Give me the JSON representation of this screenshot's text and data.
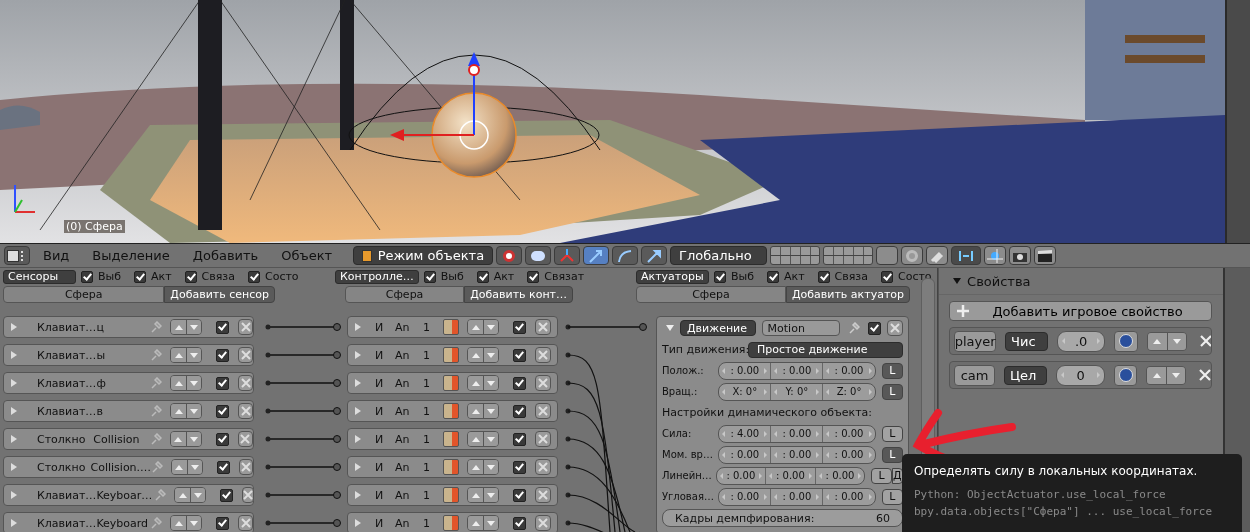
{
  "viewport": {
    "object_label": "(0) Сфера"
  },
  "header": {
    "menus": [
      "Вид",
      "Выделение",
      "Добавить",
      "Объект"
    ],
    "mode": "Режим объекта",
    "orientation": "Глобально"
  },
  "sensors": {
    "dropdown": "Сенсоры",
    "filters": [
      {
        "label": "Выб",
        "checked": true
      },
      {
        "label": "Акт",
        "checked": true
      },
      {
        "label": "Связа",
        "checked": true
      },
      {
        "label": "Состо",
        "checked": true
      }
    ],
    "object": "Сфера",
    "add_button": "Добавить сенсор",
    "items": [
      {
        "type": "Клавиат…",
        "name": "ц",
        "expanded": false,
        "active": true
      },
      {
        "type": "Клавиат…",
        "name": "ы",
        "expanded": false,
        "active": true
      },
      {
        "type": "Клавиат…",
        "name": "ф",
        "expanded": false,
        "active": true
      },
      {
        "type": "Клавиат…",
        "name": "в",
        "expanded": false,
        "active": true
      },
      {
        "type": "Столкно",
        "name": "Collision",
        "expanded": false,
        "active": true
      },
      {
        "type": "Столкно",
        "name": "Collision.…",
        "expanded": false,
        "active": true
      },
      {
        "type": "Клавиат…",
        "name": "Keyboar…",
        "expanded": false,
        "active": true
      },
      {
        "type": "Клавиат…",
        "name": "Keyboard",
        "expanded": false,
        "active": true
      }
    ]
  },
  "controllers": {
    "dropdown": "Контролле…",
    "filters": [
      {
        "label": "Выб",
        "checked": true
      },
      {
        "label": "Акт",
        "checked": true
      },
      {
        "label": "Связат",
        "checked": true
      }
    ],
    "object": "Сфера",
    "add_button": "Добавить конт…",
    "items": [
      {
        "type": "И",
        "name": "An",
        "state": "1",
        "expanded": false,
        "active": true
      },
      {
        "type": "И",
        "name": "An",
        "state": "1",
        "expanded": false,
        "active": true
      },
      {
        "type": "И",
        "name": "An",
        "state": "1",
        "expanded": false,
        "active": true
      },
      {
        "type": "И",
        "name": "An",
        "state": "1",
        "expanded": false,
        "active": true
      },
      {
        "type": "И",
        "name": "An",
        "state": "1",
        "expanded": false,
        "active": true
      },
      {
        "type": "И",
        "name": "An",
        "state": "1",
        "expanded": false,
        "active": true
      },
      {
        "type": "И",
        "name": "An",
        "state": "1",
        "expanded": false,
        "active": true
      },
      {
        "type": "И",
        "name": "An",
        "state": "1",
        "expanded": false,
        "active": true
      }
    ]
  },
  "actuators": {
    "dropdown": "Актуаторы",
    "filters": [
      {
        "label": "Выб",
        "checked": true
      },
      {
        "label": "Акт",
        "checked": true
      },
      {
        "label": "Связа",
        "checked": true
      },
      {
        "label": "Состо",
        "checked": true
      }
    ],
    "object": "Сфера",
    "add_button": "Добавить актуатор",
    "items": [
      {
        "type": "Движение",
        "name": "Motion",
        "expanded": true,
        "active": true,
        "motion_label": "Тип движения:",
        "motion_type": "Простое движение",
        "rows": [
          {
            "kind": "vector",
            "label": "Полож.:",
            "values": [
              ": 0.00",
              ": 0.00",
              ": 0.00"
            ],
            "toggles": [
              {
                "label": "L",
                "on": true
              }
            ]
          },
          {
            "kind": "vector",
            "label": "Вращ.:",
            "values": [
              "X:  0°",
              "Y:  0°",
              "Z:  0°"
            ],
            "toggles": [
              {
                "label": "L",
                "on": true
              }
            ]
          },
          {
            "kind": "heading",
            "label": "Настройки динамического объекта:"
          },
          {
            "kind": "vector",
            "label": "Сила:",
            "values": [
              ": 4.00",
              ": 0.00",
              ": 0.00"
            ],
            "toggles": [
              {
                "label": "L",
                "on": false
              }
            ]
          },
          {
            "kind": "vector",
            "label": "Мом. вр…",
            "values": [
              ": 0.00",
              ": 0.00",
              ": 0.00"
            ],
            "toggles": [
              {
                "label": "L",
                "on": true
              }
            ]
          },
          {
            "kind": "vector",
            "label": "Линейн…",
            "values": [
              ": 0.00",
              ": 0.00",
              ": 0.00"
            ],
            "toggles": [
              {
                "label": "L",
                "on": false
              },
              {
                "label": "Д",
                "on": false
              }
            ]
          },
          {
            "kind": "vector",
            "label": "Угловая…",
            "values": [
              ": 0.00",
              ": 0.00",
              ": 0.00"
            ],
            "toggles": [
              {
                "label": "L",
                "on": false
              }
            ]
          }
        ],
        "damping": {
          "label": "Кадры демпфирования:",
          "value": "60"
        }
      }
    ]
  },
  "properties": {
    "title": "Свойства",
    "expanded": true,
    "add_button": "Добавить игровое свойство",
    "items": [
      {
        "name": "player",
        "type": "Чис",
        "value": ".0"
      },
      {
        "name": "cam",
        "type": "Цел",
        "value": "0"
      }
    ]
  },
  "tooltip": {
    "title": "Определять силу в локальных координатах.",
    "python": [
      "Python: ObjectActuator.use_local_force",
      "bpy.data.objects[\"Сфера\"] ... use_local_force"
    ]
  }
}
